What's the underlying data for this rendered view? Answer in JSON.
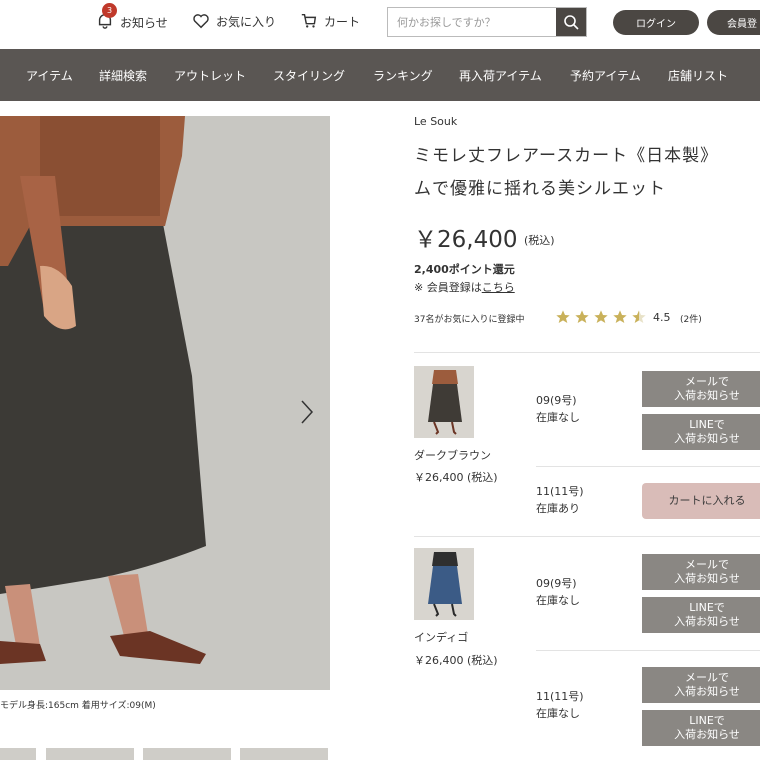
{
  "header": {
    "notice_label": "お知らせ",
    "notice_badge": "3",
    "favorites_label": "お気に入り",
    "cart_label": "カート",
    "search_placeholder": "何かお探しですか？",
    "login_label": "ログイン",
    "member_label": "会員登"
  },
  "nav": {
    "items": [
      "アイテム",
      "詳細検索",
      "アウトレット",
      "スタイリング",
      "ランキング",
      "再入荷アイテム",
      "予約アイテム",
      "店舗リスト"
    ]
  },
  "gallery": {
    "model_caption": "モデル身長:165cm 着用サイズ:09(M)"
  },
  "product": {
    "brand": "Le Souk",
    "title_line1": "ミモレ丈フレアースカート《日本製》",
    "title_line2": "ムで優雅に揺れる美シルエット",
    "price": "￥26,400",
    "tax": "(税込)",
    "points": "2,400ポイント還元",
    "register_prefix": "※ 会員登録は",
    "register_link": "こちら",
    "favorite_count_text": "37名がお気に入りに登録中",
    "rating_value": 4.5,
    "rating_text": "4.5",
    "reviews_text": "(2件)"
  },
  "variants": [
    {
      "color": "ダークブラウン",
      "price": "￥26,400 (税込)",
      "swatch": "#3f3b36",
      "sizes": [
        {
          "size": "09(9号)",
          "stock": "在庫なし",
          "buttons": [
            "メールで\n入荷お知らせ",
            "LINEで\n入荷お知らせ"
          ]
        },
        {
          "size": "11(11号)",
          "stock": "在庫あり",
          "buttons": [
            "カートに入れる"
          ]
        }
      ]
    },
    {
      "color": "インディゴ",
      "price": "￥26,400 (税込)",
      "swatch": "#3b5b86",
      "sizes": [
        {
          "size": "09(9号)",
          "stock": "在庫なし",
          "buttons": [
            "メールで\n入荷お知らせ",
            "LINEで\n入荷お知らせ"
          ]
        },
        {
          "size": "11(11号)",
          "stock": "在庫なし",
          "buttons": [
            "メールで\n入荷お知らせ",
            "LINEで\n入荷お知らせ"
          ]
        }
      ]
    }
  ],
  "colors": {
    "nav_bg": "#5a5653",
    "button_dark": "#4b4743",
    "notify_button": "#8a8783",
    "cart_button": "#d9bcb8",
    "star": "#c9b15a"
  }
}
